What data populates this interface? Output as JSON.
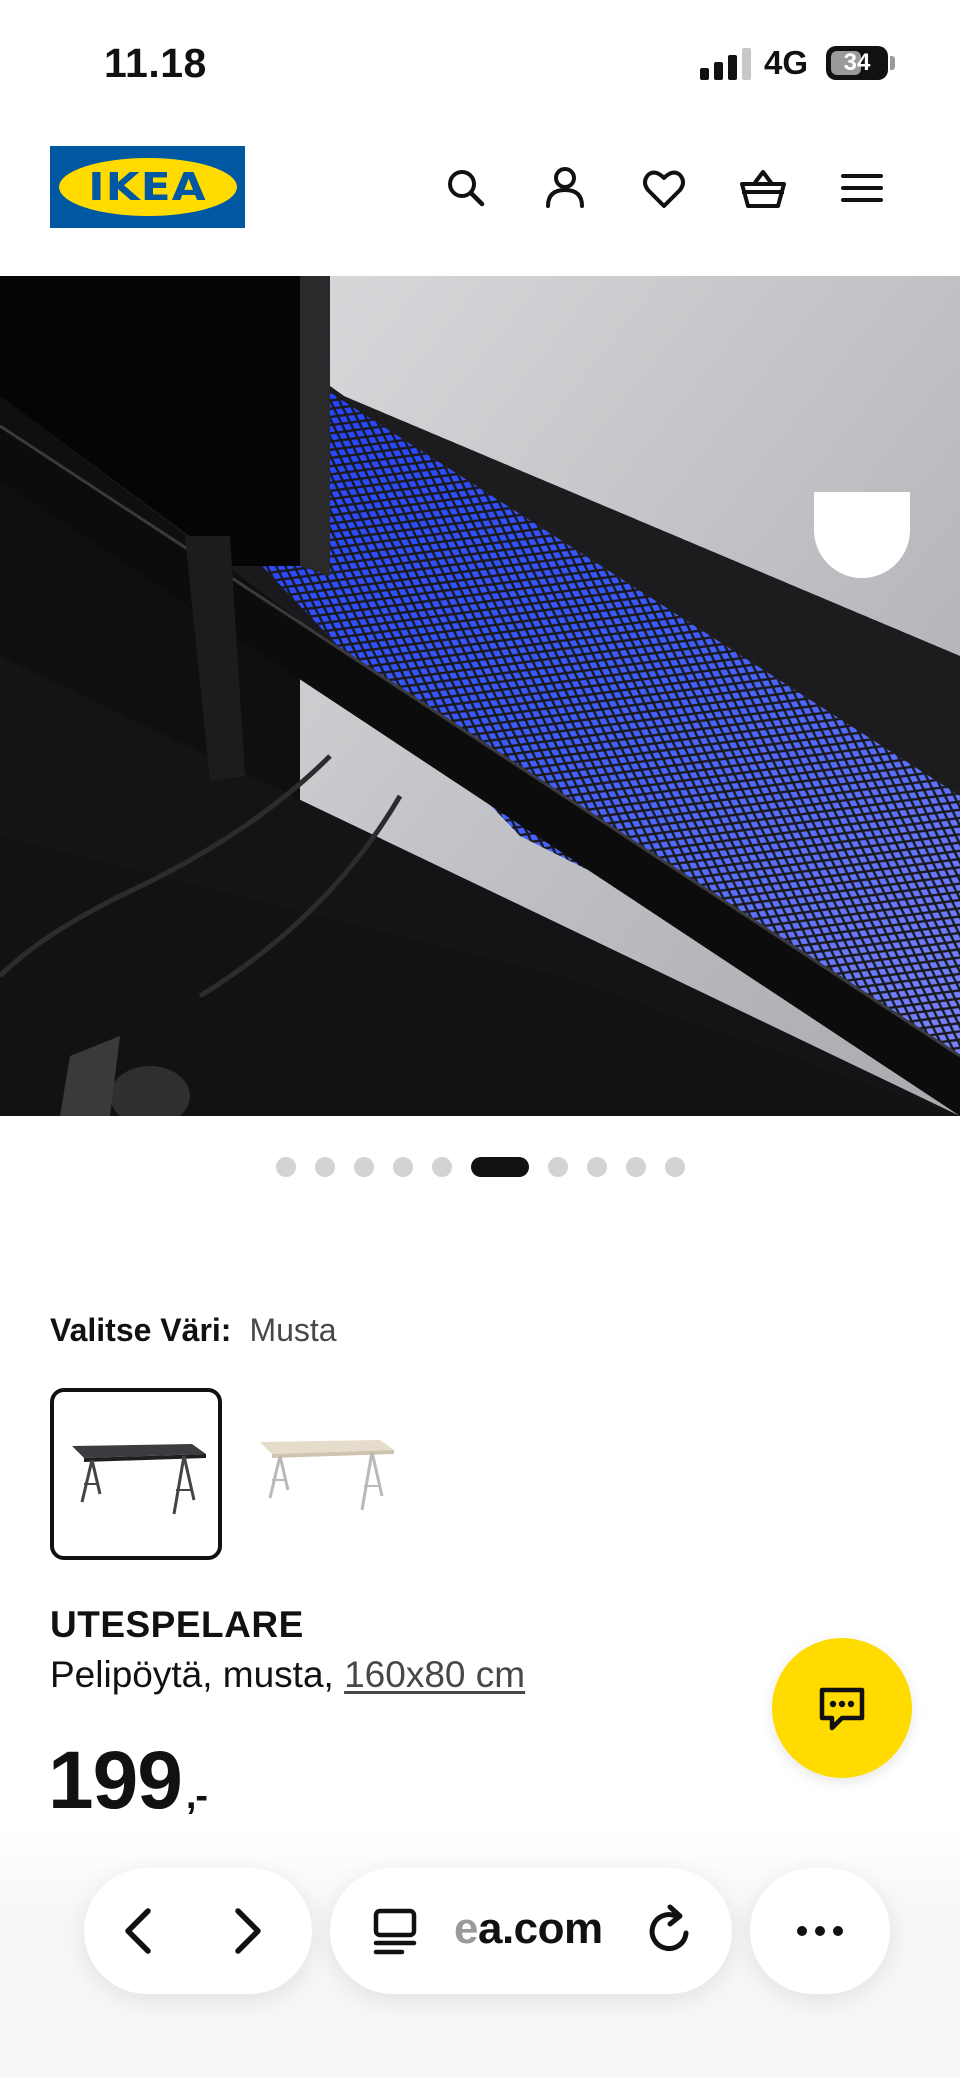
{
  "status_bar": {
    "time": "11.18",
    "network": "4G",
    "battery": "34"
  },
  "header": {
    "logo_text": "IKEA",
    "icons": [
      "search-icon",
      "account-icon",
      "heart-icon",
      "basket-icon",
      "menu-icon"
    ]
  },
  "carousel": {
    "total": 10,
    "active_index": 5
  },
  "color_select": {
    "label": "Valitse Väri:",
    "value": "Musta",
    "options": [
      "black-desk",
      "white-desk"
    ]
  },
  "product": {
    "name": "UTESPELARE",
    "desc": "Pelipöytä, musta,",
    "size": "160x80 cm",
    "price": "199",
    "price_suffix": ",-"
  },
  "browser": {
    "url_faded": "e",
    "url": "a.com"
  },
  "colors": {
    "ikea_blue": "#0058a3",
    "ikea_yellow": "#ffdb00",
    "text": "#111111"
  }
}
